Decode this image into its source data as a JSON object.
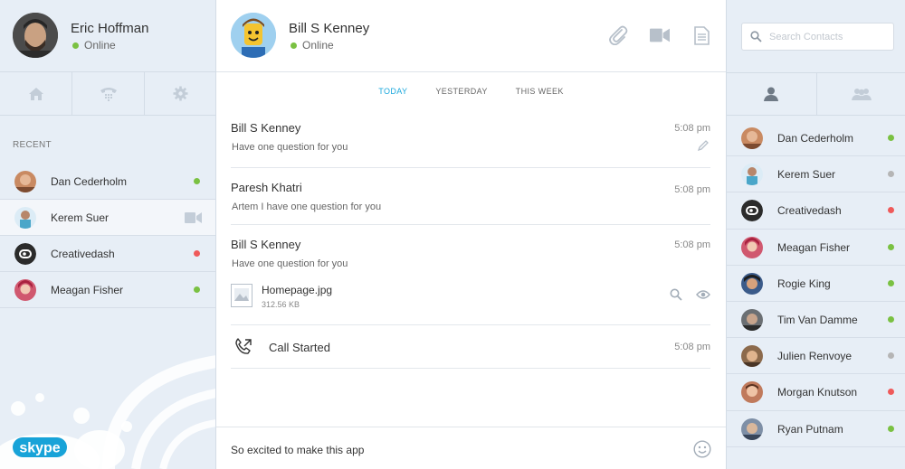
{
  "colors": {
    "online": "#7ac142",
    "away": "#b5b5b5",
    "busy": "#ef5a5a",
    "accent": "#1ba8dd"
  },
  "me": {
    "name": "Eric Hoffman",
    "status": "Online"
  },
  "left_nav": [
    {
      "icon": "home-icon"
    },
    {
      "icon": "phone-dialpad-icon"
    },
    {
      "icon": "gear-icon"
    }
  ],
  "recent": {
    "label": "RECENT",
    "items": [
      {
        "name": "Dan Cederholm",
        "status": "online",
        "avatar_color": "#c98a62"
      },
      {
        "name": "Kerem Suer",
        "status": "video",
        "avatar_color": "#8fbfdc"
      },
      {
        "name": "Creativedash",
        "status": "busy",
        "avatar_color": "#2b2b2b"
      },
      {
        "name": "Meagan Fisher",
        "status": "online",
        "avatar_color": "#d0586f"
      }
    ]
  },
  "brand": "skype",
  "chat": {
    "contact": {
      "name": "Bill S Kenney",
      "status": "Online"
    },
    "header_icons": [
      "paperclip-icon",
      "video-camera-icon",
      "document-icon"
    ],
    "tabs": [
      {
        "label": "TODAY",
        "active": true
      },
      {
        "label": "YESTERDAY",
        "active": false
      },
      {
        "label": "THIS WEEK",
        "active": false
      }
    ],
    "messages": [
      {
        "from": "Bill S Kenney",
        "text": "Have one question for you",
        "time": "5:08 pm"
      },
      {
        "from": "Paresh Khatri",
        "text": "Artem I have one question for you",
        "time": "5:08 pm"
      },
      {
        "from": "Bill S Kenney",
        "text": "Have one question for you",
        "time": "5:08 pm",
        "file": {
          "name": "Homepage.jpg",
          "size": "312.56 KB"
        }
      },
      {
        "event": "Call Started",
        "time": "5:08 pm"
      }
    ],
    "composer_text": "So excited to make this app"
  },
  "search": {
    "placeholder": "Search Contacts"
  },
  "contact_tabs": [
    "person-icon",
    "group-icon"
  ],
  "contacts": [
    {
      "name": "Dan Cederholm",
      "status": "online",
      "avatar_color": "#c98a62"
    },
    {
      "name": "Kerem Suer",
      "status": "away",
      "avatar_color": "#8fbfdc"
    },
    {
      "name": "Creativedash",
      "status": "busy",
      "avatar_color": "#2b2b2b"
    },
    {
      "name": "Meagan Fisher",
      "status": "online",
      "avatar_color": "#d0586f"
    },
    {
      "name": "Rogie King",
      "status": "online",
      "avatar_color": "#3b5b8a"
    },
    {
      "name": "Tim Van Damme",
      "status": "online",
      "avatar_color": "#6b6f73"
    },
    {
      "name": "Julien Renvoye",
      "status": "away",
      "avatar_color": "#8c6a4c"
    },
    {
      "name": "Morgan Knutson",
      "status": "busy",
      "avatar_color": "#c07a5c"
    },
    {
      "name": "Ryan Putnam",
      "status": "online",
      "avatar_color": "#7e8fa6"
    }
  ]
}
